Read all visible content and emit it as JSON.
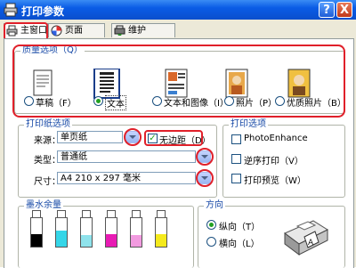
{
  "window": {
    "title": "打印参数",
    "help_label": "?",
    "close_label": "X"
  },
  "tabs": [
    {
      "label": "主窗口",
      "icon": "printer-icon"
    },
    {
      "label": "页面",
      "icon": "page-setup-icon"
    },
    {
      "label": "维护",
      "icon": "maintenance-icon"
    }
  ],
  "quality": {
    "title": "质量选项（Q）",
    "options": [
      {
        "label": "草稿（F）",
        "selected": false
      },
      {
        "label": "文本",
        "selected": true
      },
      {
        "label": "文本和图像（I）",
        "selected": false
      },
      {
        "label": "照片（P）",
        "selected": false
      },
      {
        "label": "优质照片（B）",
        "selected": false
      }
    ]
  },
  "paper": {
    "title": "打印纸选项",
    "source_label": "来源：",
    "source_value": "单页纸",
    "borderless_label": "无边距（D）",
    "borderless_checked": true,
    "type_label": "类型：",
    "type_value": "普通纸",
    "size_label": "尺寸：",
    "size_value": "A4 210 x 297 毫米"
  },
  "print_options": {
    "title": "打印选项",
    "items": [
      {
        "label": "PhotoEnhance",
        "checked": false
      },
      {
        "label": "逆序打印（V）",
        "checked": false
      },
      {
        "label": "打印预览（W）",
        "checked": false
      }
    ]
  },
  "ink": {
    "title": "墨水余量",
    "cartridges": [
      {
        "color": "#000000",
        "level": 0.45
      },
      {
        "color": "#35d6e8",
        "level": 0.55
      },
      {
        "color": "#8fe3ec",
        "level": 0.4
      },
      {
        "color": "#e81bb4",
        "level": 0.45
      },
      {
        "color": "#f29be0",
        "level": 0.4
      },
      {
        "color": "#f5ea1c",
        "level": 0.45
      }
    ]
  },
  "orientation": {
    "title": "方向",
    "options": [
      {
        "label": "纵向（T）",
        "selected": true
      },
      {
        "label": "横向（L）",
        "selected": false
      }
    ]
  },
  "colors": {
    "accent_red": "#e0202a",
    "group_title": "#1648a6",
    "title_bar": "#0a5ce6"
  }
}
